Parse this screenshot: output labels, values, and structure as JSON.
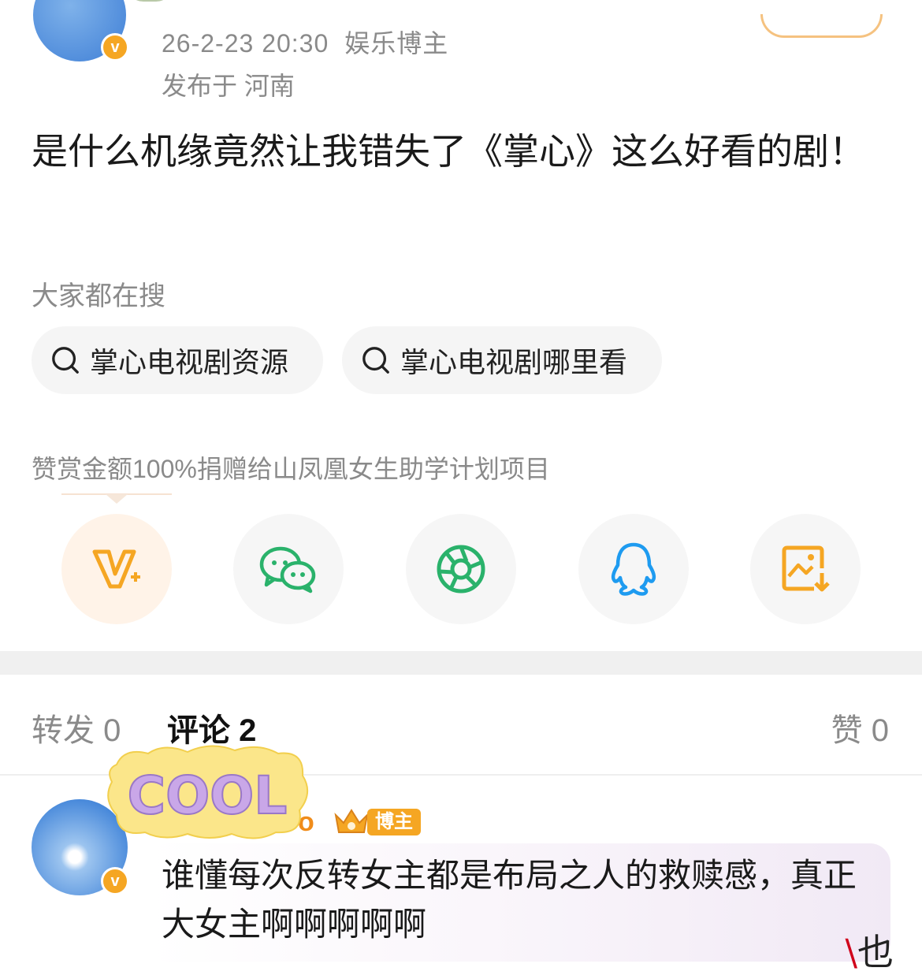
{
  "post": {
    "timestamp": "26-2-23 20:30",
    "author_tag": "娱乐博主",
    "location": "发布于 河南",
    "verified_badge": "v",
    "text": "是什么机缘竟然让我错失了《掌心》这么好看的剧！"
  },
  "search": {
    "title": "大家都在搜",
    "chips": [
      {
        "label": "掌心电视剧资源",
        "icon": "search-icon"
      },
      {
        "label": "掌心电视剧哪里看",
        "icon": "search-icon"
      }
    ]
  },
  "reward_note": "赞赏金额100%捐赠给山凤凰女生助学计划项目",
  "share": {
    "buttons": [
      {
        "icon": "vplus-icon",
        "color": "#f5a623"
      },
      {
        "icon": "wechat-icon",
        "color": "#2ab26b"
      },
      {
        "icon": "moments-icon",
        "color": "#2ab26b"
      },
      {
        "icon": "qq-icon",
        "color": "#1e9bf0"
      },
      {
        "icon": "save-image-icon",
        "color": "#f5a623"
      }
    ]
  },
  "tabs": {
    "repost": "转发 0",
    "comment": "评论 2",
    "like": "赞 0"
  },
  "comment": {
    "name_tail": "o",
    "badge": "博主",
    "sticker_text": "COOL",
    "text": "谁懂每次反转女主都是布局之人的救赎感，真正大女主啊啊啊啊啊",
    "verified_badge": "v"
  },
  "corner": {
    "char": "也",
    "slash": "\\"
  },
  "colors": {
    "accent": "#f5a623",
    "muted_text": "#8a8a8a",
    "wechat_green": "#2ab26b",
    "qq_blue": "#1e9bf0"
  }
}
